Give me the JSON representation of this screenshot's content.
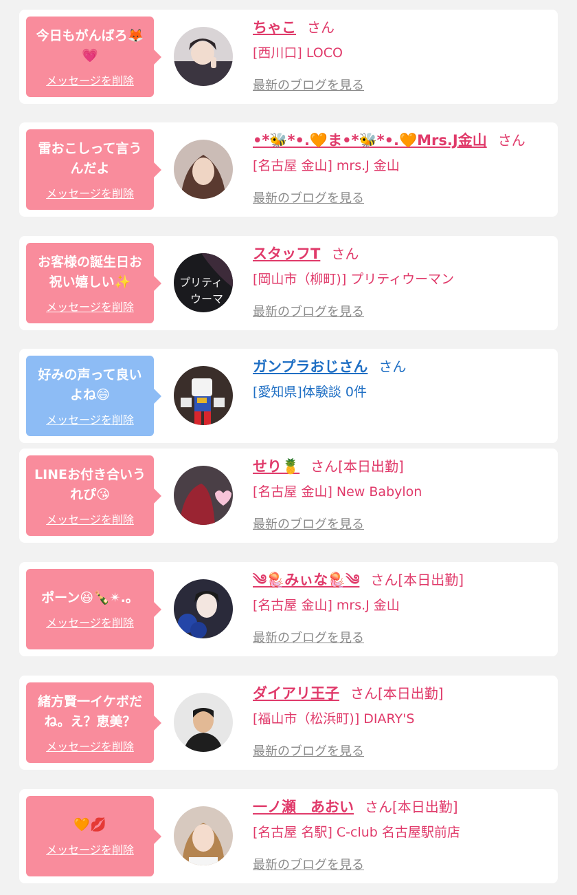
{
  "delete_label": "メッセージを削除",
  "blog_label": "最新のブログを見る",
  "san_label": "さん",
  "colors": {
    "pink_bubble": "#f98c9c",
    "blue_bubble": "#8dbcf5",
    "pink_text": "#e03a6a",
    "blue_text": "#1f6fc4",
    "link_gray": "#8a8a8a",
    "background": "#f2f2f2"
  },
  "messages": [
    {
      "message": "今日もがんばろ🦊💗",
      "name": "ちゃこ",
      "suffix": "",
      "shop": "[西川口] LOCO",
      "theme": "pink",
      "has_blog": true,
      "avatar": "photo-woman-peace-sign"
    },
    {
      "message": "雷おこしって言うんだよ",
      "name": "•*🐝*•.🧡ま•*🐝*•.🧡Mrs.J金山",
      "suffix": "",
      "shop": "[名古屋 金山] mrs.J 金山",
      "theme": "pink",
      "has_blog": true,
      "avatar": "photo-woman-portrait"
    },
    {
      "message": "お客様の誕生日お祝い嬉しい✨",
      "name": "スタッフT",
      "suffix": "",
      "shop": "[岡山市（柳町)] プリティウーマン",
      "theme": "pink",
      "has_blog": true,
      "avatar": "photo-pretty-woman-logo"
    },
    {
      "message": "好みの声って良いよね😄",
      "name": "ガンプラおじさん",
      "suffix": "",
      "shop": "[愛知県]体験談 0件",
      "theme": "blue",
      "has_blog": false,
      "avatar": "photo-gundam-model"
    },
    {
      "message": "LINEお付き合いうれぴ😘",
      "name": "せり🍍",
      "suffix": "[本日出勤]",
      "shop": "[名古屋 金山] New Babylon",
      "theme": "pink",
      "has_blog": true,
      "avatar": "photo-woman-heart"
    },
    {
      "message": "ポーン😆🍾✴︎.。",
      "name": "༄🪼みぃな🪼༄",
      "suffix": "[本日出勤]",
      "shop": "[名古屋 金山] mrs.J 金山",
      "theme": "pink",
      "has_blog": true,
      "avatar": "photo-woman-blue-flowers"
    },
    {
      "message": "緒方賢一イケボだね。え？恵美？",
      "name": "ダイアリ王子",
      "suffix": "[本日出勤]",
      "shop": "[福山市（松浜町)] DIARY'S",
      "theme": "pink",
      "has_blog": true,
      "avatar": "photo-man-portrait"
    },
    {
      "message": "🧡💋",
      "name": "一ノ瀬　あおい",
      "suffix": "[本日出勤]",
      "shop": "[名古屋 名駅] C-club 名古屋駅前店",
      "theme": "pink",
      "has_blog": true,
      "avatar": "photo-woman-smiling"
    }
  ]
}
